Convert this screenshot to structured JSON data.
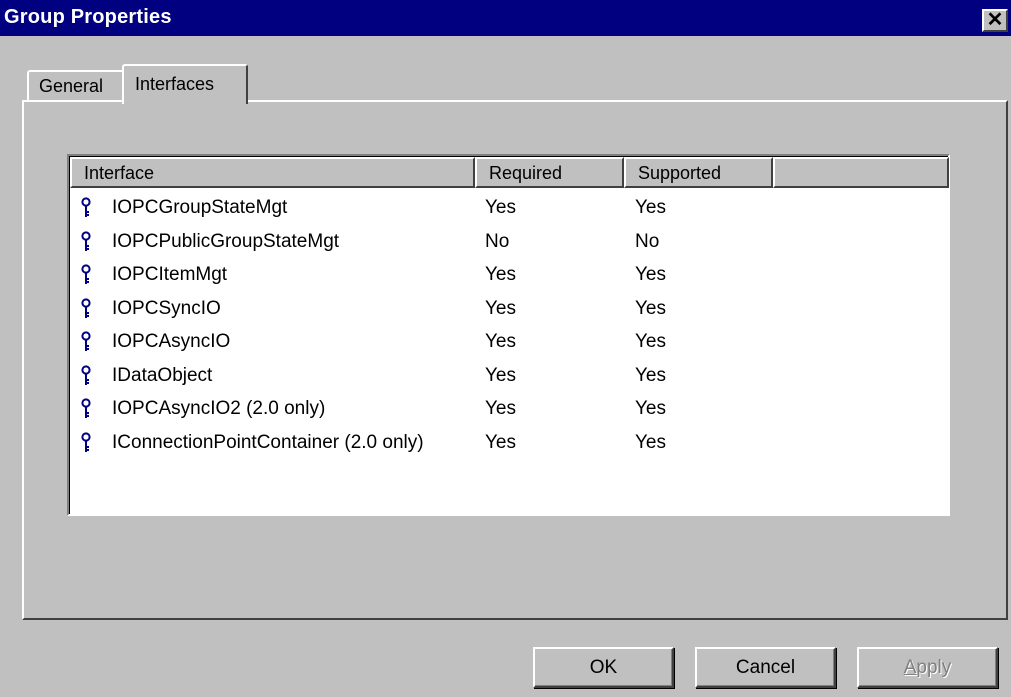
{
  "window": {
    "title": "Group Properties",
    "close_glyph": "✕"
  },
  "tabs": [
    {
      "label": "General",
      "active": false
    },
    {
      "label": "Interfaces",
      "active": true
    }
  ],
  "table": {
    "columns": [
      "Interface",
      "Required",
      "Supported"
    ],
    "row_icon": "interface-key-icon",
    "rows": [
      {
        "name": "IOPCGroupStateMgt",
        "required": "Yes",
        "supported": "Yes"
      },
      {
        "name": "IOPCPublicGroupStateMgt",
        "required": "No",
        "supported": "No"
      },
      {
        "name": "IOPCItemMgt",
        "required": "Yes",
        "supported": "Yes"
      },
      {
        "name": "IOPCSyncIO",
        "required": "Yes",
        "supported": "Yes"
      },
      {
        "name": "IOPCAsyncIO",
        "required": "Yes",
        "supported": "Yes"
      },
      {
        "name": "IDataObject",
        "required": "Yes",
        "supported": "Yes"
      },
      {
        "name": "IOPCAsyncIO2 (2.0 only)",
        "required": "Yes",
        "supported": "Yes"
      },
      {
        "name": "IConnectionPointContainer (2.0 only)",
        "required": "Yes",
        "supported": "Yes"
      }
    ]
  },
  "buttons": {
    "ok": "OK",
    "cancel": "Cancel",
    "apply": "Apply"
  },
  "colors": {
    "titlebar": "#000080",
    "face": "#c0c0c0",
    "icon": "#000080",
    "disabled_text": "#808080"
  }
}
